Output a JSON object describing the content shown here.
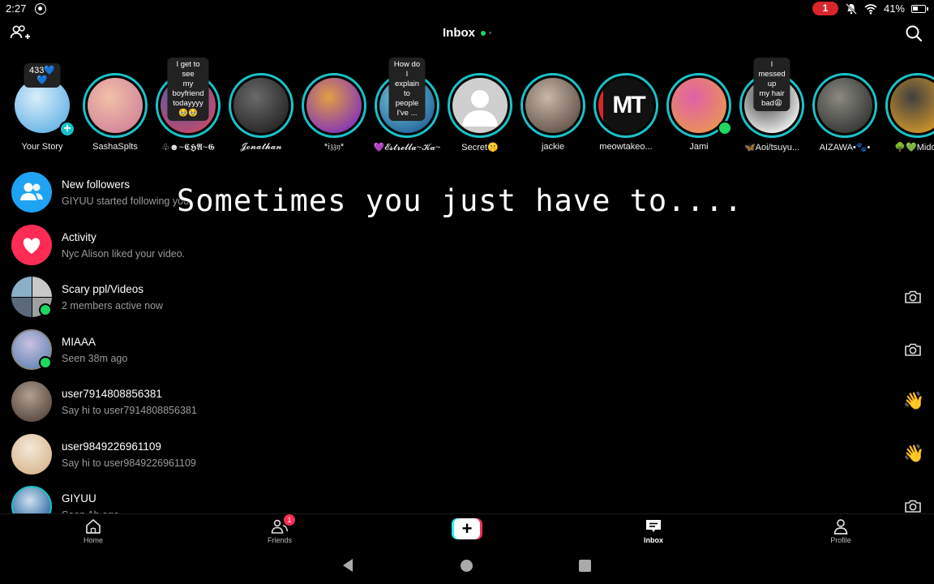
{
  "status_bar": {
    "time": "2:27",
    "notif_count": "1",
    "battery": "41%"
  },
  "header": {
    "title": "Inbox",
    "add_friends_icon": "add-people-icon",
    "search_icon": "search-icon"
  },
  "stories": [
    {
      "name": "Your Story",
      "bubble": "433💙💙",
      "note_style": true,
      "ring": "none",
      "plus": true,
      "colors": [
        "#6fb8e8",
        "#d8eef8"
      ]
    },
    {
      "name": "SashaSplts",
      "bubble": "",
      "ring": "teal",
      "colors": [
        "#d48a9a",
        "#f2c0a8"
      ]
    },
    {
      "name": "♧☻~𝕮𝕳𝕬~𝕲",
      "bubble": "I get to see\nmy boyfriend\ntodayyyy🥹🥹",
      "ring": "teal",
      "colors": [
        "#c04a6a",
        "#3a60b8"
      ]
    },
    {
      "name": "𝓙𝓸𝓷𝓪𝓽𝓱𝓪𝓷",
      "bubble": "",
      "ring": "teal",
      "colors": [
        "#2a2a2a",
        "#6a6a6a"
      ]
    },
    {
      "name": "*𝔦𝔷𝔷𝔶*",
      "bubble": "",
      "ring": "teal",
      "colors": [
        "#8a3ab0",
        "#e0a040"
      ]
    },
    {
      "name": "💜𝓔𝓼𝓽𝓻𝓮𝓵𝓵𝓪~𝓚𝓪~",
      "bubble": "How do I\nexplain to\npeople I've ...",
      "ring": "teal",
      "colors": [
        "#2a6aa0",
        "#7ad0d8"
      ]
    },
    {
      "name": "Secret🤫",
      "bubble": "",
      "ring": "teal",
      "colors": [
        "#d8d8d8",
        "#f4f4f4"
      ]
    },
    {
      "name": "jackie",
      "bubble": "",
      "ring": "teal",
      "colors": [
        "#6a5a50",
        "#c8b8a8"
      ]
    },
    {
      "name": "meowtakeo...",
      "bubble": "",
      "ring": "teal",
      "colors": [
        "#101010",
        "#101010"
      ]
    },
    {
      "name": "Jami",
      "bubble": "",
      "ring": "teal",
      "online": true,
      "colors": [
        "#e8905a",
        "#e060a8"
      ]
    },
    {
      "name": "🦋Aoi/tsuyu...",
      "bubble": "I messed up\nmy hair bad😩",
      "ring": "teal",
      "colors": [
        "#e8e8e8",
        "#404040"
      ]
    },
    {
      "name": "AIZAWA•🐾•",
      "bubble": "",
      "ring": "teal",
      "colors": [
        "#3a3a3a",
        "#8a8a80"
      ]
    },
    {
      "name": "🌳💚Midori",
      "bubble": "",
      "ring": "teal",
      "colors": [
        "#c8902a",
        "#404040"
      ]
    }
  ],
  "story_extras": {
    "meow_logo": "MT"
  },
  "rows": [
    {
      "title": "New followers",
      "subtitle": "GIYUU started following you.",
      "kind": "followers",
      "action": ""
    },
    {
      "title": "Activity",
      "subtitle": "Nyc Alison liked your video.",
      "kind": "activity",
      "action": ""
    },
    {
      "title": "Scary ppl/Videos",
      "subtitle": "2 members active now",
      "kind": "group",
      "online": true,
      "action": "camera-icon"
    },
    {
      "title": "MIAAA",
      "subtitle": "Seen 38m ago",
      "kind": "user",
      "online": true,
      "action": "camera-icon",
      "colors": [
        "#6a8ab8",
        "#c8c0e0"
      ]
    },
    {
      "title": "user7914808856381",
      "subtitle": "Say hi to user7914808856381",
      "kind": "user",
      "action": "wave-icon",
      "colors": [
        "#5a4a40",
        "#b0a090"
      ]
    },
    {
      "title": "user9849226961109",
      "subtitle": "Say hi to user9849226961109",
      "kind": "user",
      "action": "wave-icon",
      "colors": [
        "#d8b890",
        "#f4e8d8"
      ]
    },
    {
      "title": "GIYUU",
      "subtitle": "Seen 1h ago",
      "kind": "user",
      "action": "camera-icon",
      "colors": [
        "#2a6aa0",
        "#d0e0f0"
      ]
    }
  ],
  "wave_emoji": "👋",
  "caption": "Sometimes you just have to....",
  "bottom_nav": {
    "home": "Home",
    "friends": "Friends",
    "friends_badge": "1",
    "create": "+",
    "inbox": "Inbox",
    "profile": "Profile"
  },
  "colors": {
    "accent_teal": "#19c3c9",
    "online_green": "#1ed760",
    "followers_blue": "#1fa3f3",
    "activity_pink": "#fe2c55"
  }
}
